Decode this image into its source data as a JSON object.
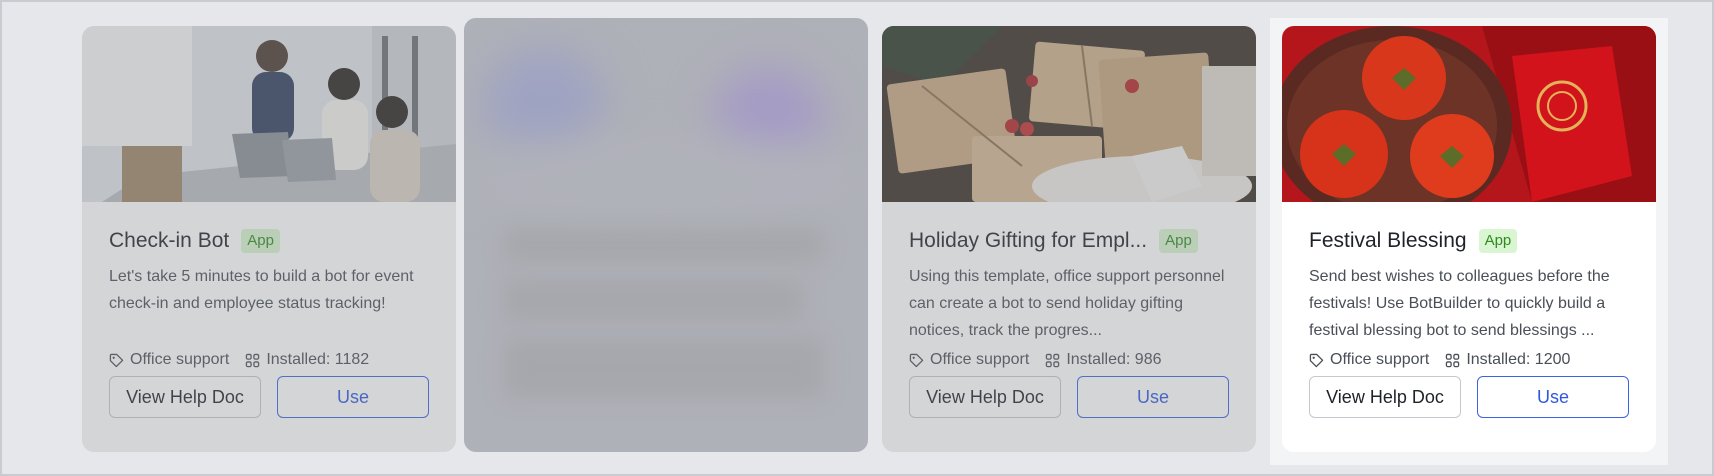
{
  "cards": [
    {
      "title": "Check-in Bot",
      "badge": "App",
      "description": "Let's take 5 minutes to build a bot for event check-in and employee status tracking!",
      "category": "Office support",
      "installed": "Installed: 1182",
      "help_label": "View Help Doc",
      "use_label": "Use",
      "thumb_icon": "office-meeting-photo"
    },
    {
      "title": "Holiday Gifting for Empl...",
      "badge": "App",
      "description": "Using this template, office support personnel can create a bot to send holiday gifting notices, track the progres...",
      "category": "Office support",
      "installed": "Installed: 986",
      "help_label": "View Help Doc",
      "use_label": "Use",
      "thumb_icon": "gift-boxes-photo"
    },
    {
      "title": "Festival Blessing",
      "badge": "App",
      "description": "Send best wishes to colleagues before the festivals! Use BotBuilder to quickly build a festival blessing bot to send blessings ...",
      "category": "Office support",
      "installed": "Installed: 1200",
      "help_label": "View Help Doc",
      "use_label": "Use",
      "thumb_icon": "festival-persimmons-photo"
    }
  ],
  "colors": {
    "accent": "#2f58e0",
    "badge_bg": "#d9f5d1",
    "badge_text": "#2e8b1f"
  }
}
